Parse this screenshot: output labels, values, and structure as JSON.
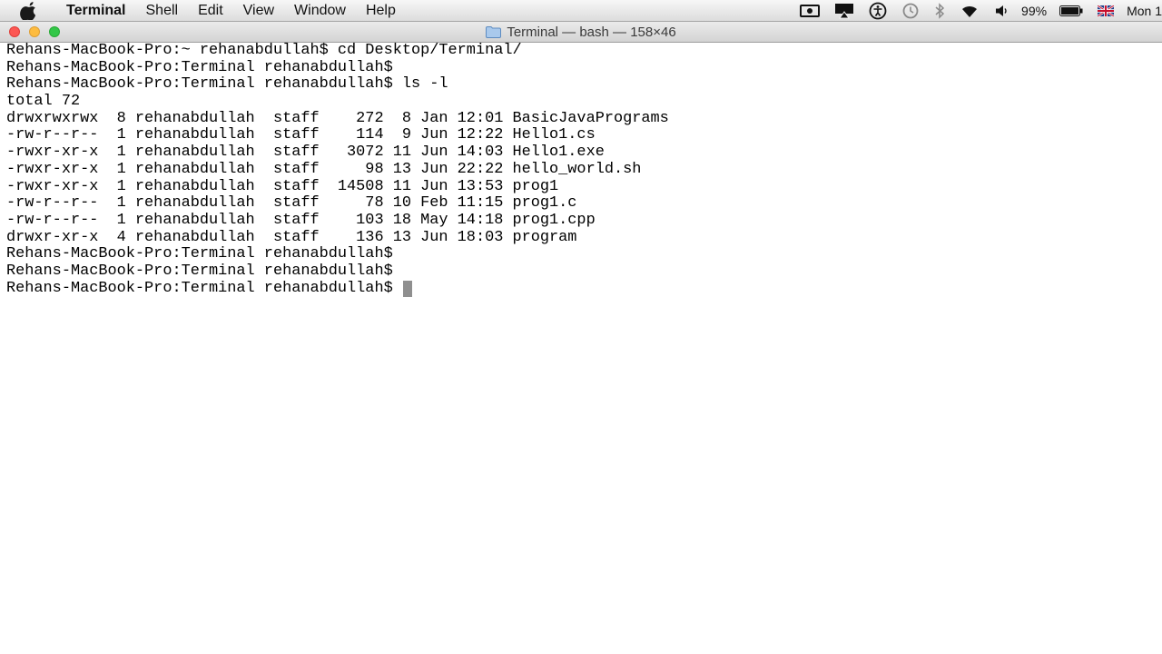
{
  "menubar": {
    "app_name": "Terminal",
    "items": [
      "Shell",
      "Edit",
      "View",
      "Window",
      "Help"
    ],
    "battery": "99%",
    "clock": "Mon 1"
  },
  "window": {
    "title": "Terminal — bash — 158×46"
  },
  "terminal": {
    "lines": [
      "Rehans-MacBook-Pro:~ rehanabdullah$ cd Desktop/Terminal/",
      "Rehans-MacBook-Pro:Terminal rehanabdullah$",
      "Rehans-MacBook-Pro:Terminal rehanabdullah$ ls -l",
      "total 72",
      "drwxrwxrwx  8 rehanabdullah  staff    272  8 Jan 12:01 BasicJavaPrograms",
      "-rw-r--r--  1 rehanabdullah  staff    114  9 Jun 12:22 Hello1.cs",
      "-rwxr-xr-x  1 rehanabdullah  staff   3072 11 Jun 14:03 Hello1.exe",
      "-rwxr-xr-x  1 rehanabdullah  staff     98 13 Jun 22:22 hello_world.sh",
      "-rwxr-xr-x  1 rehanabdullah  staff  14508 11 Jun 13:53 prog1",
      "-rw-r--r--  1 rehanabdullah  staff     78 10 Feb 11:15 prog1.c",
      "-rw-r--r--  1 rehanabdullah  staff    103 18 May 14:18 prog1.cpp",
      "drwxr-xr-x  4 rehanabdullah  staff    136 13 Jun 18:03 program",
      "Rehans-MacBook-Pro:Terminal rehanabdullah$",
      "Rehans-MacBook-Pro:Terminal rehanabdullah$"
    ],
    "prompt": "Rehans-MacBook-Pro:Terminal rehanabdullah$ "
  },
  "icons": [
    "apple-icon",
    "facetime-camera-icon",
    "airplay-icon",
    "accessibility-icon",
    "time-machine-icon",
    "bluetooth-icon",
    "wifi-icon",
    "volume-icon",
    "battery-icon",
    "uk-flag-icon",
    "folder-icon"
  ]
}
